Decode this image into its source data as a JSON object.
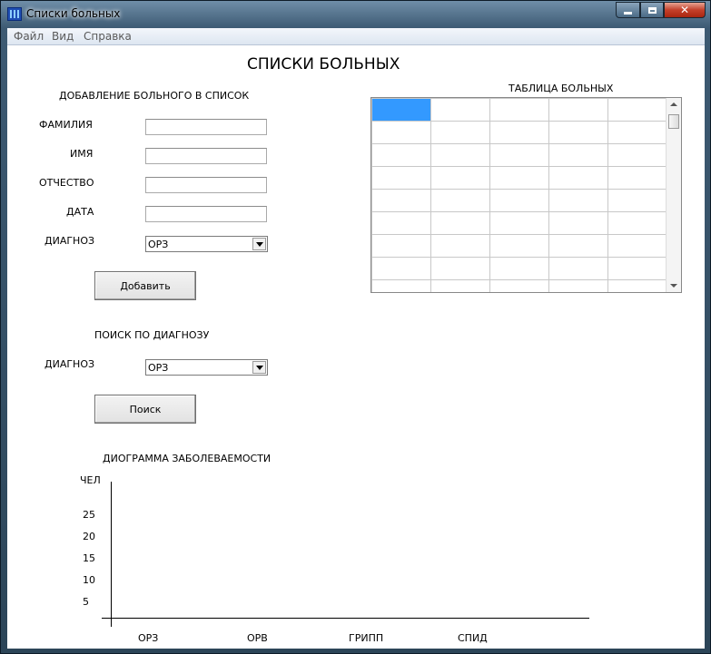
{
  "window": {
    "title": "Списки больных"
  },
  "menu": [
    "Файл",
    "Вид",
    "Справка"
  ],
  "page_title": "СПИСКИ БОЛЬНЫХ",
  "add_form": {
    "heading": "ДОБАВЛЕНИЕ БОЛЬНОГО В СПИСОК",
    "labels": {
      "surname": "ФАМИЛИЯ",
      "name": "ИМЯ",
      "patronymic": "ОТЧЕСТВО",
      "date": "ДАТА",
      "diagnosis": "ДИАГНОЗ"
    },
    "values": {
      "surname": "",
      "name": "",
      "patronymic": "",
      "date": ""
    },
    "diagnosis_selected": "ОРЗ",
    "add_button": "Добавить"
  },
  "search": {
    "heading": "ПОИСК ПО ДИАГНОЗУ",
    "diagnosis_label": "ДИАГНОЗ",
    "diagnosis_selected": "ОРЗ",
    "search_button": "Поиск"
  },
  "table": {
    "title": "ТАБЛИЦА БОЛЬНЫХ",
    "columns": 5,
    "visible_rows": 9
  },
  "chart_data": {
    "type": "bar",
    "title": "ДИОГРАММА ЗАБОЛЕВАЕМОСТИ",
    "ylabel": "ЧЕЛ",
    "xlabel": "",
    "yticks": [
      25,
      20,
      15,
      10,
      5
    ],
    "categories": [
      "ОРЗ",
      "ОРВ",
      "ГРИПП",
      "СПИД"
    ],
    "values": [
      null,
      null,
      null,
      null
    ]
  }
}
